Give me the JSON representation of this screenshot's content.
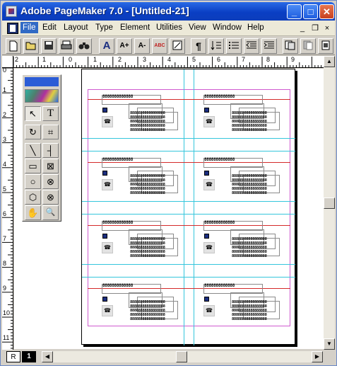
{
  "window": {
    "title": "Adobe PageMaker 7.0 - [Untitled-21]",
    "caption_buttons": {
      "minimize": "_",
      "maximize": "□",
      "close": "✕"
    }
  },
  "menubar": {
    "items": [
      "File",
      "Edit",
      "Layout",
      "Type",
      "Element",
      "Utilities",
      "View",
      "Window",
      "Help"
    ],
    "mdi": {
      "minimize": "_",
      "restore": "❐",
      "close": "×"
    }
  },
  "toolbar": {
    "buttons": [
      {
        "icon": "new-document-icon",
        "glyph": ""
      },
      {
        "icon": "open-folder-icon",
        "glyph": ""
      },
      {
        "icon": "save-disk-icon",
        "glyph": ""
      },
      {
        "icon": "print-icon",
        "glyph": ""
      },
      {
        "icon": "find-binoculars-icon",
        "glyph": ""
      },
      {
        "icon": "text-size-icon",
        "glyph": "A"
      },
      {
        "icon": "increase-font-icon",
        "glyph": "A+"
      },
      {
        "icon": "decrease-font-icon",
        "glyph": "A-"
      },
      {
        "icon": "spelling-icon",
        "glyph": "ABC"
      },
      {
        "icon": "frame-icon",
        "glyph": ""
      },
      {
        "icon": "paragraph-icon",
        "glyph": "¶"
      },
      {
        "icon": "text-direction-icon",
        "glyph": ""
      },
      {
        "icon": "bullet-list-icon",
        "glyph": ""
      },
      {
        "icon": "decrease-indent-icon",
        "glyph": ""
      },
      {
        "icon": "increase-indent-icon",
        "glyph": ""
      },
      {
        "icon": "copy-page-icon",
        "glyph": ""
      },
      {
        "icon": "paste-page-icon",
        "glyph": ""
      },
      {
        "icon": "document-icon",
        "glyph": ""
      }
    ]
  },
  "rulers": {
    "horizontal": [
      "2",
      "1",
      "0",
      "1",
      "2",
      "3",
      "4",
      "5",
      "6",
      "7",
      "8",
      "9"
    ],
    "vertical": [
      "0",
      "1",
      "2",
      "3",
      "4",
      "5",
      "6",
      "7",
      "8",
      "9",
      "10",
      "11"
    ]
  },
  "toolbox": {
    "tools": [
      {
        "name": "pointer-tool",
        "glyph": "↖",
        "pressed": true
      },
      {
        "name": "text-tool",
        "glyph": "T",
        "pressed": false
      },
      {
        "name": "rotate-tool",
        "glyph": "↻",
        "pressed": false
      },
      {
        "name": "crop-tool",
        "glyph": "⌗",
        "pressed": false
      },
      {
        "name": "line-tool",
        "glyph": "╲",
        "pressed": false
      },
      {
        "name": "constrained-line-tool",
        "glyph": "┤",
        "pressed": false
      },
      {
        "name": "rectangle-tool",
        "glyph": "▭",
        "pressed": false
      },
      {
        "name": "rectangle-frame-tool",
        "glyph": "⊠",
        "pressed": false
      },
      {
        "name": "ellipse-tool",
        "glyph": "○",
        "pressed": false
      },
      {
        "name": "ellipse-frame-tool",
        "glyph": "⊗",
        "pressed": false
      },
      {
        "name": "polygon-tool",
        "glyph": "⬡",
        "pressed": false
      },
      {
        "name": "polygon-frame-tool",
        "glyph": "⊗",
        "pressed": false
      },
      {
        "name": "hand-tool",
        "glyph": "✋",
        "pressed": false
      },
      {
        "name": "zoom-tool",
        "glyph": "🔍",
        "pressed": false
      }
    ]
  },
  "cards": {
    "title_text": "8888888888888",
    "line_text": "88888888888888888",
    "logo_glyph": "☎",
    "count": 8
  },
  "statusbar": {
    "master_page": "R",
    "current_page": "1"
  }
}
